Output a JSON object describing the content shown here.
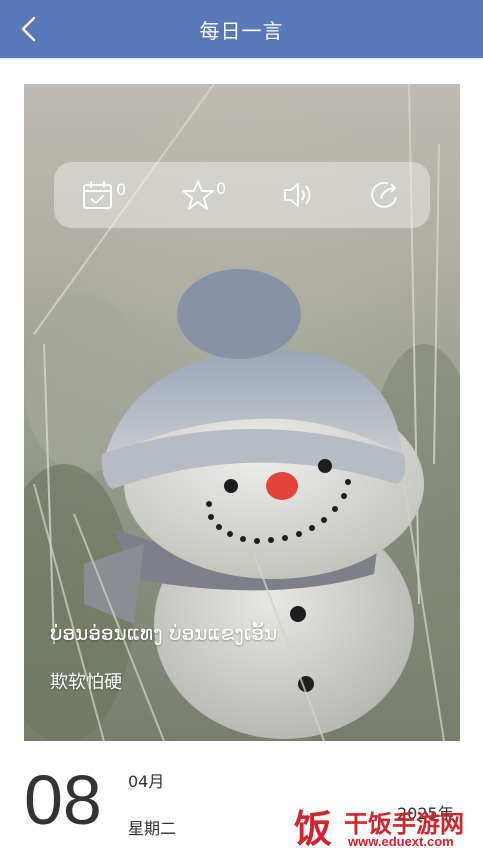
{
  "header": {
    "title": "每日一言"
  },
  "toolbar": {
    "calendar_count": "0",
    "favorite_count": "0"
  },
  "quote": {
    "lao": "ບ່ອນອ່ອນແທງ ບ່ອນແຂງເອັ້ນ",
    "chinese": "欺软怕硬"
  },
  "date": {
    "day": "08",
    "month": "04月",
    "weekday": "星期二",
    "year": "2025年"
  },
  "watermark": {
    "logo_char": "饭",
    "name": "干饭手游网",
    "url": "www.eduext.com"
  },
  "colors": {
    "header_bg": "#5a78b8",
    "watermark": "#d1252e"
  }
}
